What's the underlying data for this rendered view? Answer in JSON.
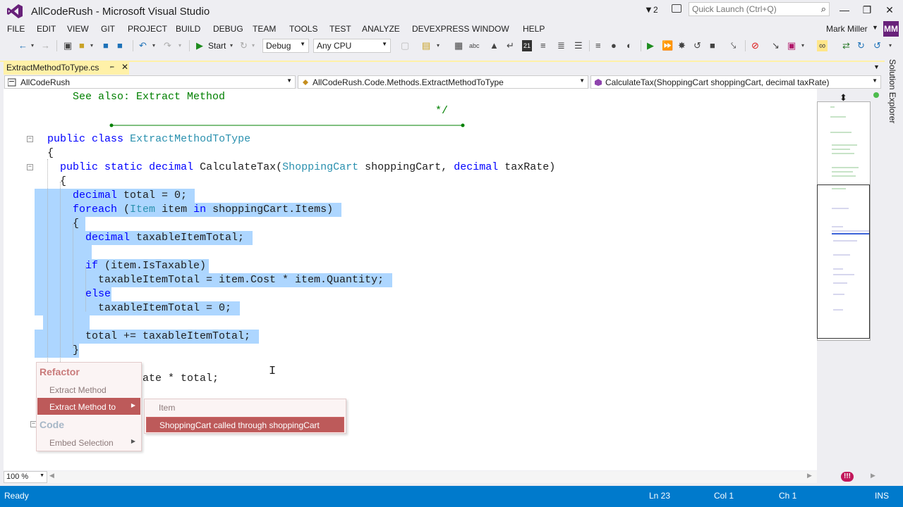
{
  "window": {
    "title": "AllCodeRush - Microsoft Visual Studio",
    "notification_count": "2",
    "quick_launch_placeholder": "Quick Launch (Ctrl+Q)",
    "controls": [
      "—",
      "❐",
      "✕"
    ]
  },
  "menu": {
    "items": [
      "FILE",
      "EDIT",
      "VIEW",
      "GIT",
      "PROJECT",
      "BUILD",
      "DEBUG",
      "TEAM",
      "TOOLS",
      "TEST",
      "ANALYZE",
      "DEVEXPRESS",
      "WINDOW",
      "HELP"
    ],
    "user_name": "Mark Miller",
    "user_initials": "MM"
  },
  "toolbar": {
    "start_label": "Start",
    "configuration": "Debug",
    "platform": "Any CPU"
  },
  "document": {
    "tab_title": "ExtractMethodToType.cs",
    "nav_project": "AllCodeRush",
    "nav_type": "AllCodeRush.Code.Methods.ExtractMethodToType",
    "nav_member": "CalculateTax(ShoppingCart shoppingCart, decimal taxRate)"
  },
  "code": {
    "see_also": "See also: Extract Method",
    "comment_end": "*/",
    "lines": {
      "class_decl": [
        "public",
        "class",
        "ExtractMethodToType"
      ],
      "open_brace": "{",
      "method_decl": [
        "public",
        "static",
        "decimal",
        "CalculateTax(",
        "ShoppingCart",
        "shoppingCart,",
        "decimal",
        "taxRate)"
      ],
      "l_total": [
        "decimal",
        "total = 0;"
      ],
      "l_foreach": [
        "foreach",
        "(",
        "Item",
        "item",
        "in",
        "shoppingCart.Items)"
      ],
      "l_taxable": [
        "decimal",
        "taxableItemTotal;"
      ],
      "l_if": [
        "if",
        "(item.IsTaxable)"
      ],
      "l_assign1": "taxableItemTotal = item.Cost * item.Quantity;",
      "l_else": "else",
      "l_assign2": "taxableItemTotal = 0;",
      "l_total_add": "total += taxableItemTotal;",
      "close_brace": "}",
      "l_return_tail": "ate * total;"
    }
  },
  "refactor_menu": {
    "category_refactor": "Refactor",
    "extract_method": "Extract Method",
    "extract_method_to": "Extract Method to",
    "category_code": "Code",
    "embed_selection": "Embed Selection"
  },
  "target_menu": {
    "item": "Item",
    "shopping_cart": "ShoppingCart called through shoppingCart"
  },
  "editor": {
    "zoom": "100 %"
  },
  "status": {
    "state": "Ready",
    "line": "Ln 23",
    "column": "Col 1",
    "char": "Ch 1",
    "mode": "INS"
  },
  "colors": {
    "status_bar": "#007acc",
    "selection": "#add6ff",
    "keyword": "#0000ff",
    "type": "#2b91af",
    "comment": "#008000",
    "menu_active": "#bd5a5a"
  }
}
